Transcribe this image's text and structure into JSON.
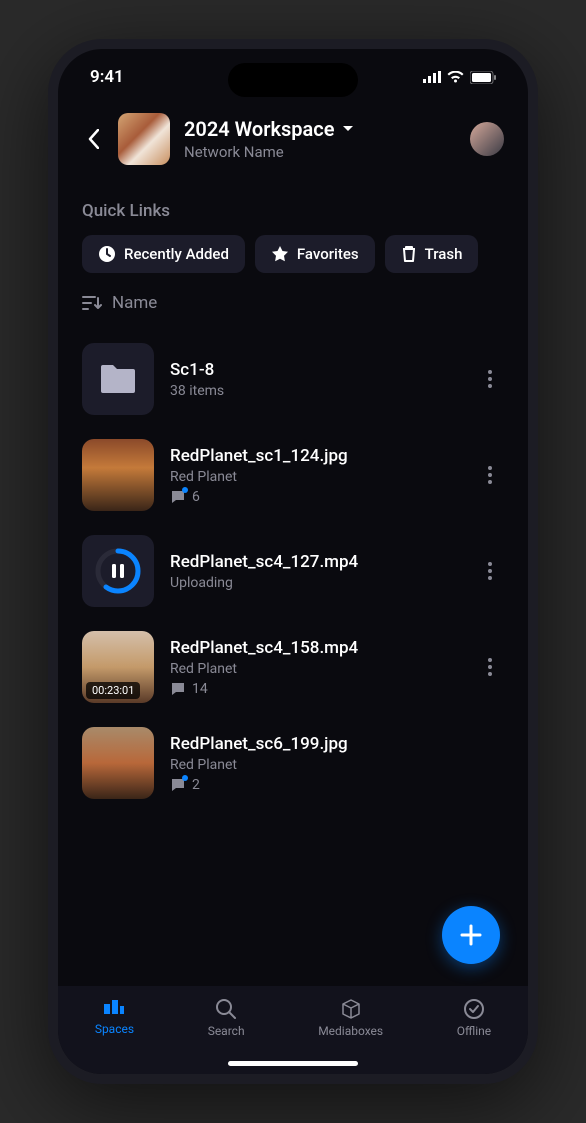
{
  "status": {
    "time": "9:41"
  },
  "header": {
    "title": "2024 Workspace",
    "subtitle": "Network Name"
  },
  "quicklinks": {
    "title": "Quick Links",
    "items": [
      {
        "label": "Recently Added",
        "icon": "clock"
      },
      {
        "label": "Favorites",
        "icon": "star"
      },
      {
        "label": "Trash",
        "icon": "trash"
      }
    ]
  },
  "sort": {
    "label": "Name"
  },
  "rows": [
    {
      "title": "Sc1-8",
      "sub": "38 items",
      "type": "folder"
    },
    {
      "title": "RedPlanet_sc1_124.jpg",
      "sub": "Red Planet",
      "comments": "6",
      "type": "image"
    },
    {
      "title": "RedPlanet_sc4_127.mp4",
      "sub": "Uploading",
      "type": "upload"
    },
    {
      "title": "RedPlanet_sc4_158.mp4",
      "sub": "Red Planet",
      "comments": "14",
      "duration": "00:23:01",
      "type": "video"
    },
    {
      "title": "RedPlanet_sc6_199.jpg",
      "sub": "Red Planet",
      "comments": "2",
      "type": "image2"
    }
  ],
  "tabs": [
    {
      "label": "Spaces",
      "active": true
    },
    {
      "label": "Search"
    },
    {
      "label": "Mediaboxes"
    },
    {
      "label": "Offline"
    }
  ]
}
